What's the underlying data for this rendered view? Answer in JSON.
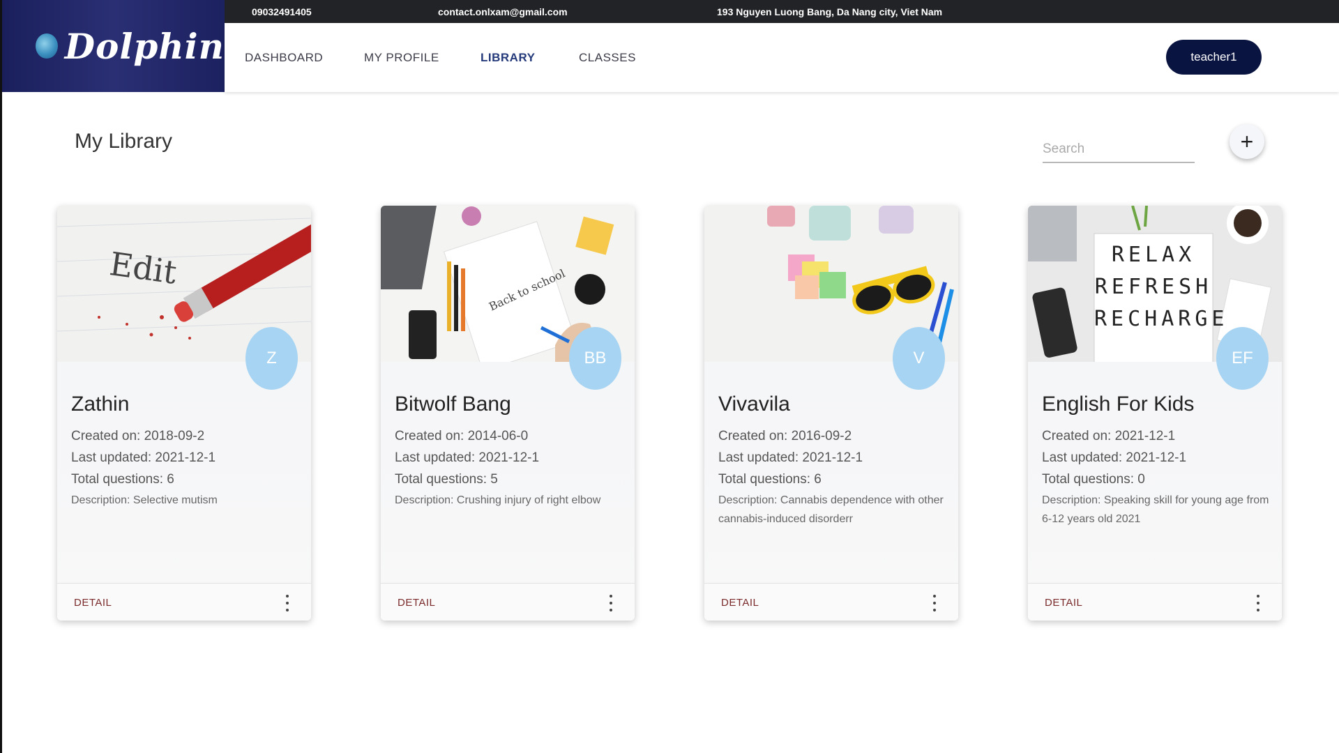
{
  "brand": {
    "name": "Dolphin"
  },
  "topbar": {
    "phone": "09032491405",
    "email": "contact.onlxam@gmail.com",
    "address": "193 Nguyen Luong Bang, Da Nang city, Viet Nam"
  },
  "nav": {
    "items": [
      {
        "label": "DASHBOARD",
        "active": false
      },
      {
        "label": "MY PROFILE",
        "active": false
      },
      {
        "label": "LIBRARY",
        "active": true
      },
      {
        "label": "CLASSES",
        "active": false
      }
    ],
    "user_label": "teacher1"
  },
  "main": {
    "title": "My Library",
    "search_placeholder": "Search",
    "add_label": "+"
  },
  "cards": [
    {
      "initials": "Z",
      "title": "Zathin",
      "created": "Created on: 2018-09-2",
      "updated": "Last updated: 2021-12-1",
      "questions": "Total questions: 6",
      "description": "Description: Selective mutism",
      "detail_label": "DETAIL",
      "image_icon": "pencil-eraser-edit-photo"
    },
    {
      "initials": "BB",
      "title": "Bitwolf Bang",
      "created": "Created on: 2014-06-0",
      "updated": "Last updated: 2021-12-1",
      "questions": "Total questions: 5",
      "description": "Description: Crushing injury of right elbow",
      "detail_label": "DETAIL",
      "image_icon": "desk-notebook-drawing-photo"
    },
    {
      "initials": "V",
      "title": "Vivavila",
      "created": "Created on: 2016-09-2",
      "updated": "Last updated: 2021-12-1",
      "questions": "Total questions: 6",
      "description": "Description: Cannabis dependence with other cannabis-induced disorderr",
      "detail_label": "DETAIL",
      "image_icon": "sunglasses-sticky-notes-photo"
    },
    {
      "initials": "EF",
      "title": "English For Kids",
      "created": "Created on: 2021-12-1",
      "updated": "Last updated: 2021-12-1",
      "questions": "Total questions: 0",
      "description": "Description: Speaking skill for young age from 6-12 years old 2021",
      "detail_label": "DETAIL",
      "image_icon": "relax-refresh-recharge-lightbox-photo",
      "image_text": [
        "RELAX",
        "REFRESH",
        "RECHARGE"
      ]
    }
  ],
  "colors": {
    "brand_bg": "#1a1f5c",
    "topbar_bg": "#222326",
    "user_btn_bg": "#0a1440",
    "avatar_bg": "#a7d4f2",
    "detail_text": "#7a2a2a"
  }
}
